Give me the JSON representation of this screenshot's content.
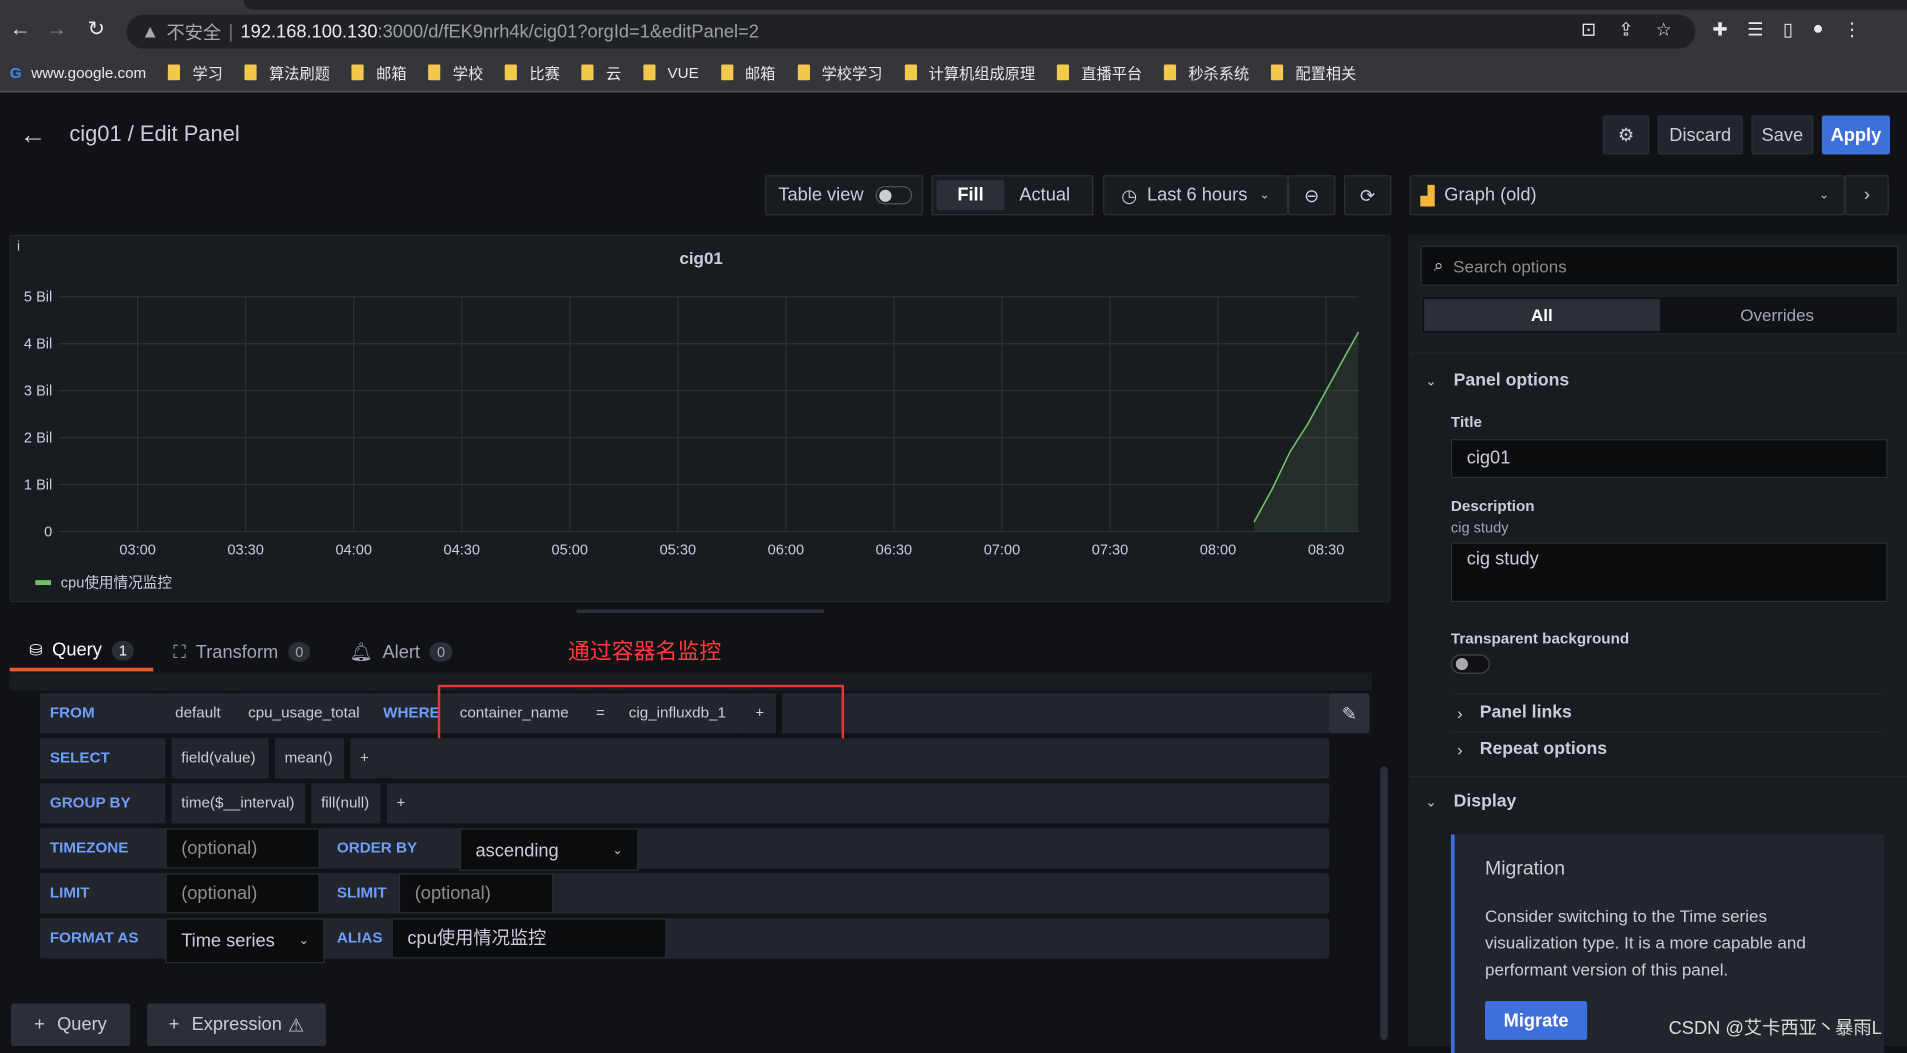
{
  "browser": {
    "security": "不安全",
    "url_host": "192.168.100.130",
    "url_rest": ":3000/d/fEK9nrh4k/cig01?orgId=1&editPanel=2",
    "bookmarks": [
      "www.google.com",
      "学习",
      "算法刷题",
      "邮箱",
      "学校",
      "比赛",
      "云",
      "VUE",
      "邮箱",
      "学校学习",
      "计算机组成原理",
      "直播平台",
      "秒杀系统",
      "配置相关"
    ]
  },
  "header": {
    "title": "cig01 / Edit Panel",
    "discard": "Discard",
    "save": "Save",
    "apply": "Apply"
  },
  "toolbar": {
    "table_view": "Table view",
    "table_view_on": false,
    "fill": "Fill",
    "actual": "Actual",
    "time_range": "Last 6 hours",
    "viz": "Graph (old)"
  },
  "panel": {
    "title": "cig01",
    "info": "i",
    "legend": "cpu使用情况监控",
    "series_color": "#73bf69"
  },
  "chart_data": {
    "type": "line",
    "title": "cig01",
    "xlim": [
      "02:38",
      "08:39"
    ],
    "ylim": [
      0,
      5
    ],
    "x_ticks": [
      "03:00",
      "03:30",
      "04:00",
      "04:30",
      "05:00",
      "05:30",
      "06:00",
      "06:30",
      "07:00",
      "07:30",
      "08:00",
      "08:30"
    ],
    "y_ticks": [
      "0",
      "1 Bil",
      "2 Bil",
      "3 Bil",
      "4 Bil",
      "5 Bil"
    ],
    "grid": true,
    "legend_placement": "bottom-left",
    "series": [
      {
        "name": "cpu使用情况监控",
        "x": [
          "08:10",
          "08:15",
          "08:20",
          "08:25",
          "08:30",
          "08:35",
          "08:39"
        ],
        "y": [
          0.2,
          0.9,
          1.7,
          2.3,
          3.0,
          3.7,
          4.25
        ]
      }
    ]
  },
  "tabs": [
    {
      "label": "Query",
      "count": "1"
    },
    {
      "label": "Transform",
      "count": "0"
    },
    {
      "label": "Alert",
      "count": "0"
    }
  ],
  "annotation": "通过容器名监控",
  "query": {
    "from": {
      "label": "FROM",
      "policy": "default",
      "measurement": "cpu_usage_total",
      "where": "WHERE",
      "key": "container_name",
      "op": "=",
      "value": "cig_influxdb_1",
      "plus": "+"
    },
    "select": {
      "label": "SELECT",
      "field": "field(value)",
      "fn": "mean()",
      "plus": "+"
    },
    "group_by": {
      "label": "GROUP BY",
      "time": "time($__interval)",
      "fill": "fill(null)",
      "plus": "+"
    },
    "timezone": {
      "label": "TIMEZONE",
      "placeholder": "(optional)",
      "order_label": "ORDER BY TIME",
      "order": "ascending"
    },
    "limit": {
      "label": "LIMIT",
      "placeholder": "(optional)",
      "slimit_label": "SLIMIT",
      "slimit_placeholder": "(optional)"
    },
    "format": {
      "label": "FORMAT AS",
      "value": "Time series",
      "alias_label": "ALIAS",
      "alias": "cpu使用情况监控"
    },
    "add_query": "Query",
    "add_expression": "Expression"
  },
  "options": {
    "search_placeholder": "Search options",
    "all": "All",
    "overrides": "Overrides",
    "panel_options": "Panel options",
    "title_label": "Title",
    "title_value": "cig01",
    "description_label": "Description",
    "description_hint": "cig study",
    "description_value": "cig study",
    "transparent_label": "Transparent background",
    "panel_links": "Panel links",
    "repeat_options": "Repeat options",
    "display": "Display",
    "migration_title": "Migration",
    "migration_text": "Consider switching to the Time series visualization type. It is a more capable and performant version of this panel.",
    "migrate": "Migrate"
  },
  "watermark": "CSDN @艾卡西亚丶暴雨L"
}
